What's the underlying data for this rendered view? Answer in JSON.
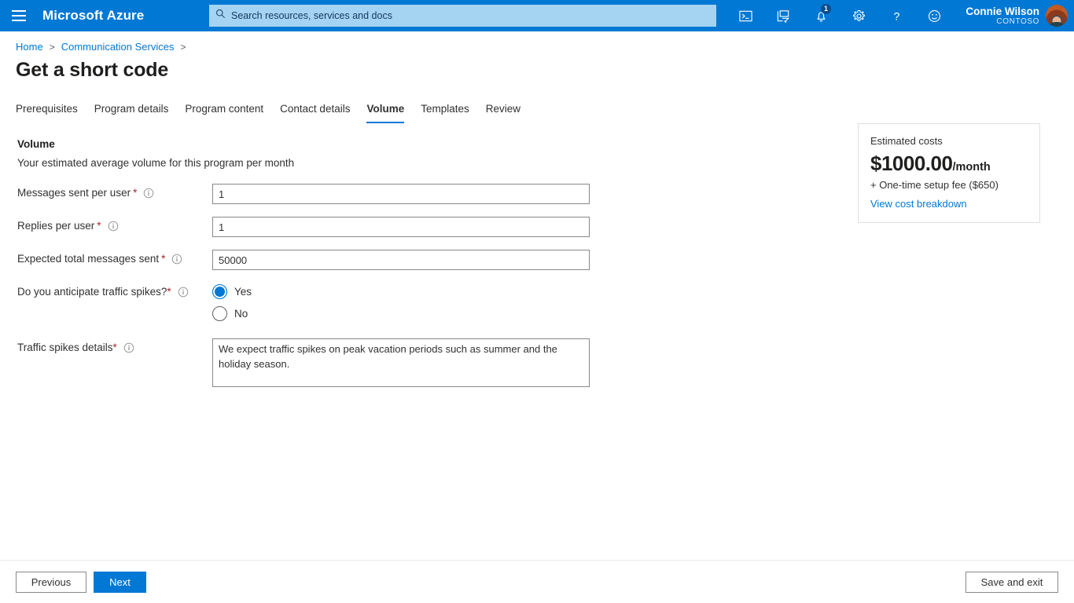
{
  "topbar": {
    "menu_icon": "hamburger-menu-icon",
    "brand": "Microsoft Azure",
    "search": {
      "placeholder": "Search resources, services and docs",
      "icon": "search-icon",
      "value": ""
    },
    "icons": [
      {
        "name": "cloud-shell-icon",
        "label": "Cloud Shell"
      },
      {
        "name": "directory-filter-icon",
        "label": "Directories + subscriptions"
      },
      {
        "name": "notifications-bell-icon",
        "label": "Notifications",
        "badge": "1"
      },
      {
        "name": "settings-gear-icon",
        "label": "Settings"
      },
      {
        "name": "help-question-icon",
        "label": "Help"
      },
      {
        "name": "feedback-smiley-icon",
        "label": "Feedback"
      }
    ],
    "user": {
      "name": "Connie Wilson",
      "org": "CONTOSO"
    }
  },
  "breadcrumb": {
    "items": [
      {
        "label": "Home"
      },
      {
        "label": "Communication Services"
      }
    ],
    "separator": ">"
  },
  "page_title": "Get a short code",
  "tabs": [
    {
      "label": "Prerequisites",
      "active": false
    },
    {
      "label": "Program details",
      "active": false
    },
    {
      "label": "Program content",
      "active": false
    },
    {
      "label": "Contact details",
      "active": false
    },
    {
      "label": "Volume",
      "active": true
    },
    {
      "label": "Templates",
      "active": false
    },
    {
      "label": "Review",
      "active": false
    }
  ],
  "section": {
    "title": "Volume",
    "subtitle": "Your estimated average volume for this program per month"
  },
  "fields": {
    "messages_sent_per_user": {
      "label": "Messages sent per user",
      "required_mark": "*",
      "value": "1"
    },
    "replies_per_user": {
      "label": "Replies per user",
      "required_mark": "*",
      "value": "1"
    },
    "expected_total_messages_sent": {
      "label": "Expected total messages sent",
      "required_mark": "*",
      "value": "50000"
    },
    "traffic_spikes": {
      "label": "Do you anticipate traffic spikes?",
      "required_mark": "*",
      "options": [
        {
          "label": "Yes",
          "selected": true
        },
        {
          "label": "No",
          "selected": false
        }
      ]
    },
    "traffic_spikes_details": {
      "label": "Traffic spikes details",
      "required_mark": "*",
      "value": "We expect traffic spikes on peak vacation periods such as summer and the holiday season."
    }
  },
  "cost_card": {
    "title": "Estimated costs",
    "amount": "$1000.00",
    "per": "/month",
    "setup_fee": "+ One-time setup fee ($650)",
    "link": "View cost breakdown"
  },
  "footer": {
    "previous": "Previous",
    "next": "Next",
    "save_and_exit": "Save and exit"
  },
  "colors": {
    "azure_blue": "#0078d4",
    "link_blue": "#0078d4",
    "required_red": "#a4262c",
    "search_bg": "#a5d3f2",
    "border_gray": "#8a8886"
  }
}
